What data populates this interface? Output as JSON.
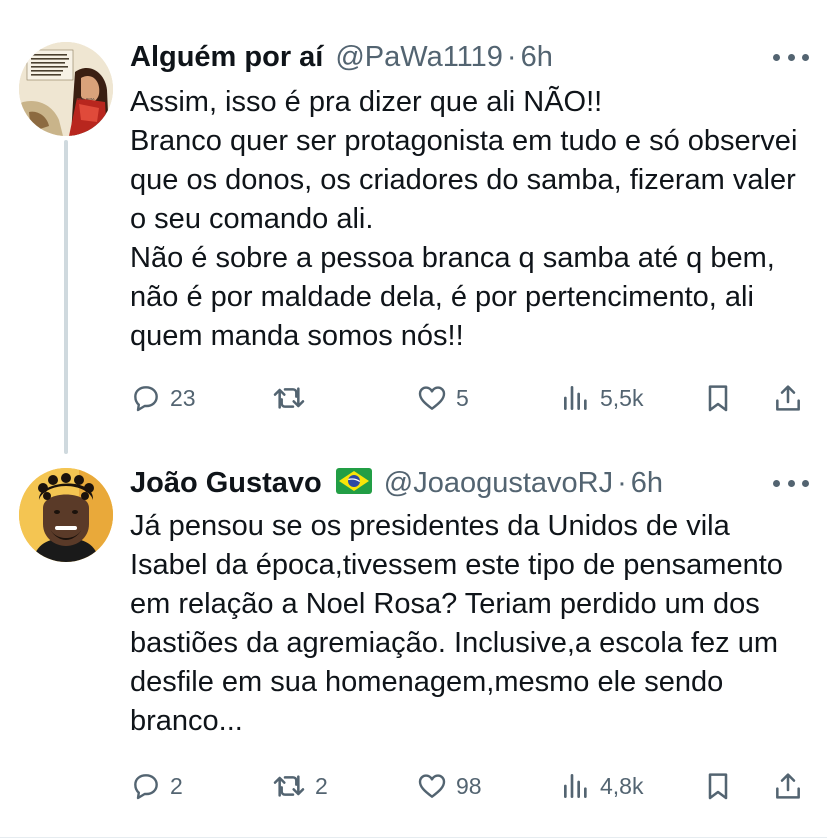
{
  "tweets": [
    {
      "author_name": "Alguém por aí",
      "handle": "@PaWa1119",
      "separator": "·",
      "time": "6h",
      "flag": "",
      "avatar_icon": "comic-avatar-icon",
      "avatar_text": "UM SOCIO NÃO PREGA ESCOLA. DE ROSA ALMEIDA A ESCOLA. POR NÃO SER ROSA. SE OS ROSA EMBRAREM ANDAN, PRECIA CAMINHOS DE FRANCISCO JUNIOR. — NOEL ROSA 1910 - 1937",
      "lines": [
        "Assim, isso é pra dizer que ali NÃO!!",
        "Branco quer ser protagonista em tudo e só observei que os donos, os criadores do samba, fizeram valer o seu comando ali.",
        "Não é sobre a pessoa branca q samba até q bem, não é por maldade dela, é por pertencimento, ali quem manda somos nós!!"
      ],
      "replies": "23",
      "retweets": "",
      "likes": "5",
      "views": "5,5k"
    },
    {
      "author_name": "João Gustavo",
      "handle": "@JoaogustavoRJ",
      "separator": "·",
      "time": "6h",
      "flag": "brazil-flag-icon",
      "avatar_icon": "profile-photo-icon",
      "lines": [
        "Já pensou se os presidentes da Unidos de vila Isabel da época,tivessem este tipo de pensamento em relação a Noel Rosa? Teriam perdido um dos bastiões da agremiação. Inclusive,a escola fez um desfile em sua homenagem,mesmo ele sendo branco..."
      ],
      "replies": "2",
      "retweets": "2",
      "likes": "98",
      "views": "4,8k"
    }
  ],
  "colors": {
    "text": "#0f1419",
    "secondary": "#536471",
    "thread_line": "#cfd9de",
    "divider": "#e6ecf0"
  },
  "icons": {
    "reply": "reply-icon",
    "retweet": "retweet-icon",
    "like": "heart-icon",
    "views": "views-icon",
    "bookmark": "bookmark-icon",
    "share": "share-icon",
    "more": "more-icon"
  }
}
